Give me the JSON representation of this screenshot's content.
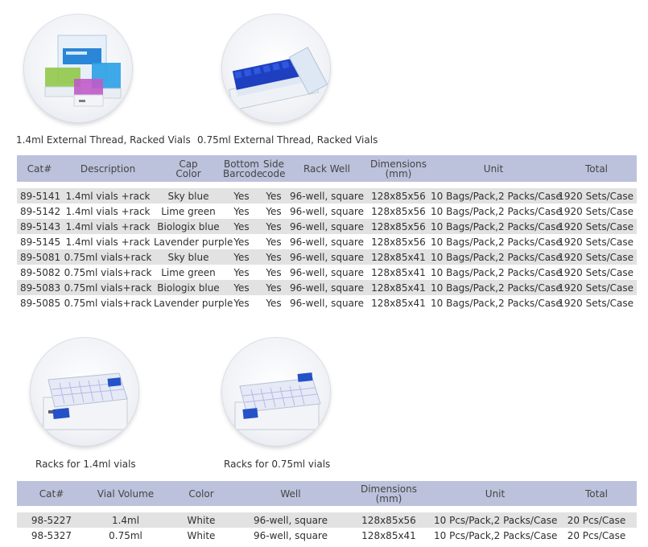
{
  "products": {
    "vials_14": {
      "caption": "1.4ml External Thread, Racked Vials"
    },
    "vials_075": {
      "caption": "0.75ml External Thread, Racked Vials"
    },
    "rack_14": {
      "caption": "Racks for 1.4ml vials"
    },
    "rack_075": {
      "caption": "Racks for 0.75ml vials"
    }
  },
  "vials_table": {
    "headers": {
      "cat": "Cat#",
      "description": "Description",
      "cap_color": "Cap Color",
      "bottom_barcode": "Bottom Barcode",
      "side_code": "Side code",
      "rack_well": "Rack Well",
      "dimensions": "Dimensions (mm)",
      "unit": "Unit",
      "total": "Total"
    },
    "rows": [
      {
        "cat": "89-5141",
        "description": "1.4ml vials +rack",
        "cap_color": "Sky blue",
        "bottom_barcode": "Yes",
        "side_code": "Yes",
        "rack_well": "96-well, square",
        "dimensions": "128x85x56",
        "unit": "10 Bags/Pack,2 Packs/Case",
        "total": "1920 Sets/Case"
      },
      {
        "cat": "89-5142",
        "description": "1.4ml vials +rack",
        "cap_color": "Lime green",
        "bottom_barcode": "Yes",
        "side_code": "Yes",
        "rack_well": "96-well, square",
        "dimensions": "128x85x56",
        "unit": "10 Bags/Pack,2 Packs/Case",
        "total": "1920 Sets/Case"
      },
      {
        "cat": "89-5143",
        "description": "1.4ml vials +rack",
        "cap_color": "Biologix blue",
        "bottom_barcode": "Yes",
        "side_code": "Yes",
        "rack_well": "96-well, square",
        "dimensions": "128x85x56",
        "unit": "10 Bags/Pack,2 Packs/Case",
        "total": "1920 Sets/Case"
      },
      {
        "cat": "89-5145",
        "description": "1.4ml vials +rack",
        "cap_color": "Lavender purple",
        "bottom_barcode": "Yes",
        "side_code": "Yes",
        "rack_well": "96-well, square",
        "dimensions": "128x85x56",
        "unit": "10 Bags/Pack,2 Packs/Case",
        "total": "1920 Sets/Case"
      },
      {
        "cat": "89-5081",
        "description": "0.75ml vials+rack",
        "cap_color": "Sky blue",
        "bottom_barcode": "Yes",
        "side_code": "Yes",
        "rack_well": "96-well, square",
        "dimensions": "128x85x41",
        "unit": "10 Bags/Pack,2 Packs/Case",
        "total": "1920 Sets/Case"
      },
      {
        "cat": "89-5082",
        "description": "0.75ml vials+rack",
        "cap_color": "Lime green",
        "bottom_barcode": "Yes",
        "side_code": "Yes",
        "rack_well": "96-well, square",
        "dimensions": "128x85x41",
        "unit": "10 Bags/Pack,2 Packs/Case",
        "total": "1920 Sets/Case"
      },
      {
        "cat": "89-5083",
        "description": "0.75ml vials+rack",
        "cap_color": "Biologix blue",
        "bottom_barcode": "Yes",
        "side_code": "Yes",
        "rack_well": "96-well, square",
        "dimensions": "128x85x41",
        "unit": "10 Bags/Pack,2 Packs/Case",
        "total": "1920 Sets/Case"
      },
      {
        "cat": "89-5085",
        "description": "0.75ml vials+rack",
        "cap_color": "Lavender purple",
        "bottom_barcode": "Yes",
        "side_code": "Yes",
        "rack_well": "96-well, square",
        "dimensions": "128x85x41",
        "unit": "10 Bags/Pack,2 Packs/Case",
        "total": "1920 Sets/Case"
      }
    ]
  },
  "racks_table": {
    "headers": {
      "cat": "Cat#",
      "vial_volume": "Vial Volume",
      "color": "Color",
      "well": "Well",
      "dimensions": "Dimensions (mm)",
      "unit": "Unit",
      "total": "Total"
    },
    "rows": [
      {
        "cat": "98-5227",
        "vial_volume": "1.4ml",
        "color": "White",
        "well": "96-well, square",
        "dimensions": "128x85x56",
        "unit": "10 Pcs/Pack,2 Packs/Case",
        "total": "20 Pcs/Case"
      },
      {
        "cat": "98-5327",
        "vial_volume": "0.75ml",
        "color": "White",
        "well": "96-well, square",
        "dimensions": "128x85x41",
        "unit": "10 Pcs/Pack,2 Packs/Case",
        "total": "20 Pcs/Case"
      }
    ]
  },
  "colors": {
    "header_bg": "#bcc2dc",
    "row_shade": "#e2e2e2",
    "sky_blue": "#3aa7e3",
    "lime_green": "#8cc63f",
    "biologix_blue": "#1e3fbf",
    "lavender_purple": "#c05ac8"
  }
}
